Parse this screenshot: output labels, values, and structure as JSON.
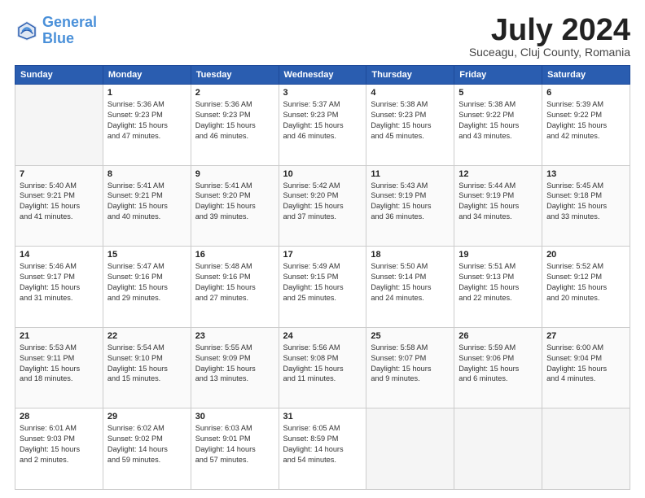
{
  "header": {
    "logo_line1": "General",
    "logo_line2": "Blue",
    "month": "July 2024",
    "location": "Suceagu, Cluj County, Romania"
  },
  "days_of_week": [
    "Sunday",
    "Monday",
    "Tuesday",
    "Wednesday",
    "Thursday",
    "Friday",
    "Saturday"
  ],
  "weeks": [
    [
      {
        "day": "",
        "info": ""
      },
      {
        "day": "1",
        "info": "Sunrise: 5:36 AM\nSunset: 9:23 PM\nDaylight: 15 hours\nand 47 minutes."
      },
      {
        "day": "2",
        "info": "Sunrise: 5:36 AM\nSunset: 9:23 PM\nDaylight: 15 hours\nand 46 minutes."
      },
      {
        "day": "3",
        "info": "Sunrise: 5:37 AM\nSunset: 9:23 PM\nDaylight: 15 hours\nand 46 minutes."
      },
      {
        "day": "4",
        "info": "Sunrise: 5:38 AM\nSunset: 9:23 PM\nDaylight: 15 hours\nand 45 minutes."
      },
      {
        "day": "5",
        "info": "Sunrise: 5:38 AM\nSunset: 9:22 PM\nDaylight: 15 hours\nand 43 minutes."
      },
      {
        "day": "6",
        "info": "Sunrise: 5:39 AM\nSunset: 9:22 PM\nDaylight: 15 hours\nand 42 minutes."
      }
    ],
    [
      {
        "day": "7",
        "info": "Sunrise: 5:40 AM\nSunset: 9:21 PM\nDaylight: 15 hours\nand 41 minutes."
      },
      {
        "day": "8",
        "info": "Sunrise: 5:41 AM\nSunset: 9:21 PM\nDaylight: 15 hours\nand 40 minutes."
      },
      {
        "day": "9",
        "info": "Sunrise: 5:41 AM\nSunset: 9:20 PM\nDaylight: 15 hours\nand 39 minutes."
      },
      {
        "day": "10",
        "info": "Sunrise: 5:42 AM\nSunset: 9:20 PM\nDaylight: 15 hours\nand 37 minutes."
      },
      {
        "day": "11",
        "info": "Sunrise: 5:43 AM\nSunset: 9:19 PM\nDaylight: 15 hours\nand 36 minutes."
      },
      {
        "day": "12",
        "info": "Sunrise: 5:44 AM\nSunset: 9:19 PM\nDaylight: 15 hours\nand 34 minutes."
      },
      {
        "day": "13",
        "info": "Sunrise: 5:45 AM\nSunset: 9:18 PM\nDaylight: 15 hours\nand 33 minutes."
      }
    ],
    [
      {
        "day": "14",
        "info": "Sunrise: 5:46 AM\nSunset: 9:17 PM\nDaylight: 15 hours\nand 31 minutes."
      },
      {
        "day": "15",
        "info": "Sunrise: 5:47 AM\nSunset: 9:16 PM\nDaylight: 15 hours\nand 29 minutes."
      },
      {
        "day": "16",
        "info": "Sunrise: 5:48 AM\nSunset: 9:16 PM\nDaylight: 15 hours\nand 27 minutes."
      },
      {
        "day": "17",
        "info": "Sunrise: 5:49 AM\nSunset: 9:15 PM\nDaylight: 15 hours\nand 25 minutes."
      },
      {
        "day": "18",
        "info": "Sunrise: 5:50 AM\nSunset: 9:14 PM\nDaylight: 15 hours\nand 24 minutes."
      },
      {
        "day": "19",
        "info": "Sunrise: 5:51 AM\nSunset: 9:13 PM\nDaylight: 15 hours\nand 22 minutes."
      },
      {
        "day": "20",
        "info": "Sunrise: 5:52 AM\nSunset: 9:12 PM\nDaylight: 15 hours\nand 20 minutes."
      }
    ],
    [
      {
        "day": "21",
        "info": "Sunrise: 5:53 AM\nSunset: 9:11 PM\nDaylight: 15 hours\nand 18 minutes."
      },
      {
        "day": "22",
        "info": "Sunrise: 5:54 AM\nSunset: 9:10 PM\nDaylight: 15 hours\nand 15 minutes."
      },
      {
        "day": "23",
        "info": "Sunrise: 5:55 AM\nSunset: 9:09 PM\nDaylight: 15 hours\nand 13 minutes."
      },
      {
        "day": "24",
        "info": "Sunrise: 5:56 AM\nSunset: 9:08 PM\nDaylight: 15 hours\nand 11 minutes."
      },
      {
        "day": "25",
        "info": "Sunrise: 5:58 AM\nSunset: 9:07 PM\nDaylight: 15 hours\nand 9 minutes."
      },
      {
        "day": "26",
        "info": "Sunrise: 5:59 AM\nSunset: 9:06 PM\nDaylight: 15 hours\nand 6 minutes."
      },
      {
        "day": "27",
        "info": "Sunrise: 6:00 AM\nSunset: 9:04 PM\nDaylight: 15 hours\nand 4 minutes."
      }
    ],
    [
      {
        "day": "28",
        "info": "Sunrise: 6:01 AM\nSunset: 9:03 PM\nDaylight: 15 hours\nand 2 minutes."
      },
      {
        "day": "29",
        "info": "Sunrise: 6:02 AM\nSunset: 9:02 PM\nDaylight: 14 hours\nand 59 minutes."
      },
      {
        "day": "30",
        "info": "Sunrise: 6:03 AM\nSunset: 9:01 PM\nDaylight: 14 hours\nand 57 minutes."
      },
      {
        "day": "31",
        "info": "Sunrise: 6:05 AM\nSunset: 8:59 PM\nDaylight: 14 hours\nand 54 minutes."
      },
      {
        "day": "",
        "info": ""
      },
      {
        "day": "",
        "info": ""
      },
      {
        "day": "",
        "info": ""
      }
    ]
  ]
}
